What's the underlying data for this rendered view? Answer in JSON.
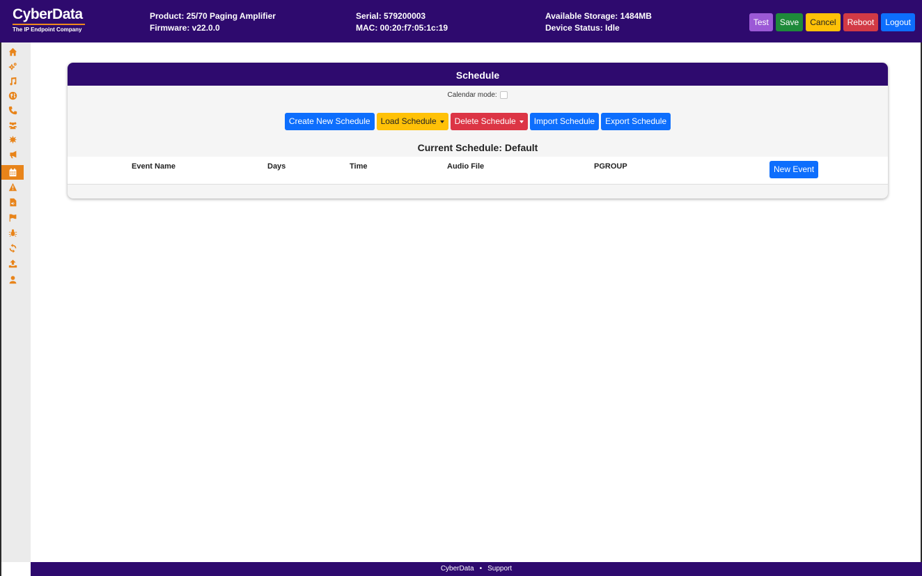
{
  "header": {
    "logo_name": "CyberData",
    "logo_tagline": "The IP Endpoint Company",
    "product": "Product: 25/70 Paging Amplifier",
    "firmware": "Firmware: v22.0.0",
    "serial": "Serial: 579200003",
    "mac": "MAC: 00:20:f7:05:1c:19",
    "storage": "Available Storage: 1484MB",
    "device_status": "Device Status: Idle",
    "buttons": {
      "test": "Test",
      "save": "Save",
      "cancel": "Cancel",
      "reboot": "Reboot",
      "logout": "Logout"
    }
  },
  "sidebar": {
    "icons": [
      "home-icon",
      "cogs-icon",
      "music-icon",
      "globe-icon",
      "phone-icon",
      "users-icon",
      "burst-icon",
      "megaphone-icon",
      "calendar-icon",
      "warning-icon",
      "audio-file-icon",
      "flag-icon",
      "bug-icon",
      "refresh-icon",
      "upload-icon",
      "user-icon"
    ],
    "active": "calendar-icon"
  },
  "schedule": {
    "title": "Schedule",
    "calendar_mode_label": "Calendar mode:",
    "buttons": {
      "create": "Create New Schedule",
      "load": "Load Schedule",
      "delete": "Delete Schedule",
      "import": "Import Schedule",
      "export": "Export Schedule"
    },
    "current_schedule": "Current Schedule: Default",
    "columns": [
      "Event Name",
      "Days",
      "Time",
      "Audio File",
      "PGROUP"
    ],
    "new_event_label": "New Event"
  },
  "footer": {
    "brand_link": "CyberData",
    "separator": "•",
    "support_link": "Support"
  },
  "colors": {
    "brand_purple": "#2e0a6e",
    "accent_orange": "#e8841a",
    "primary_blue": "#0d6efd",
    "warning_yellow": "#ffc107",
    "danger_red": "#dc3545",
    "success_green": "#1e8a3a",
    "test_purple": "#9b59d6"
  }
}
